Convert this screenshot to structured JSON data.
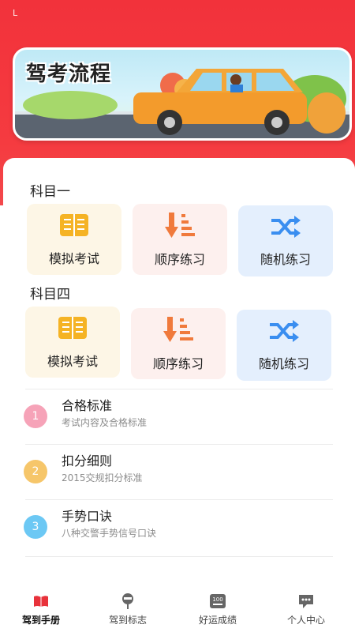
{
  "status": {
    "left_glyph": "L"
  },
  "banner": {
    "title": "驾考流程"
  },
  "subject1": {
    "title": "科目一",
    "tiles": [
      {
        "label": "模拟考试",
        "icon": "book-icon"
      },
      {
        "label": "顺序练习",
        "icon": "sort-descending-icon"
      },
      {
        "label": "随机练习",
        "icon": "shuffle-icon"
      }
    ]
  },
  "subject4": {
    "title": "科目四",
    "tiles": [
      {
        "label": "模拟考试",
        "icon": "book-icon"
      },
      {
        "label": "顺序练习",
        "icon": "sort-descending-icon"
      },
      {
        "label": "随机练习",
        "icon": "shuffle-icon"
      }
    ]
  },
  "rules": [
    {
      "num": "1",
      "title": "合格标准",
      "sub": "考试内容及合格标准",
      "color": "#f6a3b8"
    },
    {
      "num": "2",
      "title": "扣分细则",
      "sub": "2015交规扣分标准",
      "color": "#f6c66a"
    },
    {
      "num": "3",
      "title": "手势口诀",
      "sub": "八种交警手势信号口诀",
      "color": "#6cc8f4"
    }
  ],
  "tabs": [
    {
      "label": "驾到手册",
      "icon": "book-icon",
      "active": true
    },
    {
      "label": "驾到标志",
      "icon": "sign-icon",
      "active": false
    },
    {
      "label": "好运成绩",
      "icon": "score-icon",
      "active": false
    },
    {
      "label": "个人中心",
      "icon": "chat-icon",
      "active": false
    }
  ],
  "colors": {
    "header_red": "#f2323b",
    "accent_orange": "#f08a2c",
    "accent_blue": "#3a8ef0",
    "tab_active": "#e8323b"
  }
}
